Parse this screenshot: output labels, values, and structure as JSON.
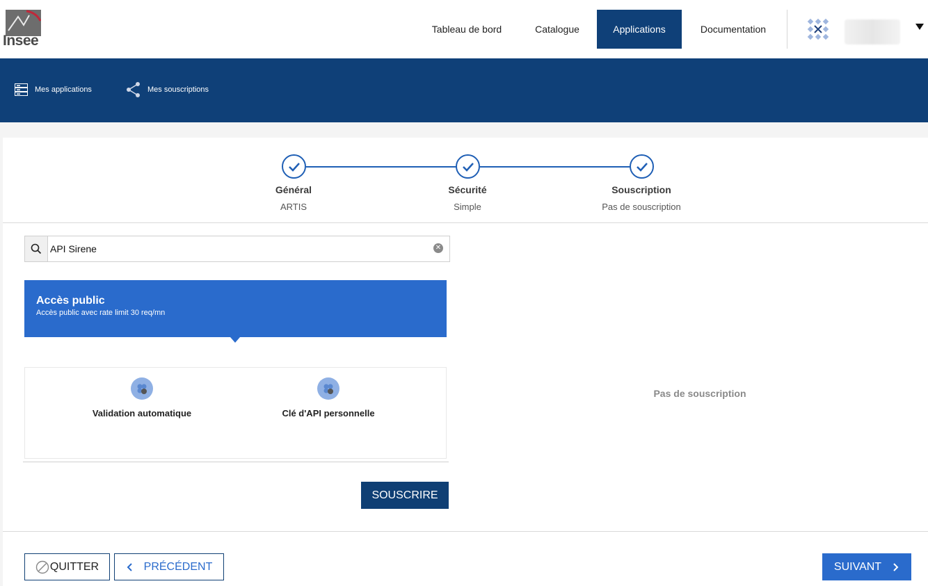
{
  "header": {
    "logo_text": "Insee",
    "nav": [
      {
        "label": "Tableau de bord",
        "active": false
      },
      {
        "label": "Catalogue",
        "active": false
      },
      {
        "label": "Applications",
        "active": true
      },
      {
        "label": "Documentation",
        "active": false
      }
    ],
    "user_menu_icon": "caret-down-icon"
  },
  "subnav": {
    "items": [
      {
        "label": "Mes applications",
        "icon": "server-list-icon"
      },
      {
        "label": "Mes souscriptions",
        "icon": "share-icon"
      }
    ]
  },
  "stepper": {
    "steps": [
      {
        "title": "Général",
        "subtitle": "ARTIS",
        "done": true
      },
      {
        "title": "Sécurité",
        "subtitle": "Simple",
        "done": true
      },
      {
        "title": "Souscription",
        "subtitle": "Pas de souscription",
        "done": true
      }
    ]
  },
  "search": {
    "value": "API Sirene"
  },
  "plan": {
    "title": "Accès public",
    "description": "Accès public avec rate limit 30 req/mn"
  },
  "features": [
    {
      "label": "Validation automatique",
      "icon": "feature-badge-icon"
    },
    {
      "label": "Clé d'API personnelle",
      "icon": "feature-badge-icon"
    }
  ],
  "subscribe_button": "SOUSCRIRE",
  "empty_state": "Pas de souscription",
  "footer": {
    "quit": "QUITTER",
    "previous": "PRÉCÉDENT",
    "next": "SUIVANT"
  },
  "colors": {
    "primary_dark": "#0f4078",
    "primary": "#2a6bcc",
    "background": "#f4f4f4"
  }
}
